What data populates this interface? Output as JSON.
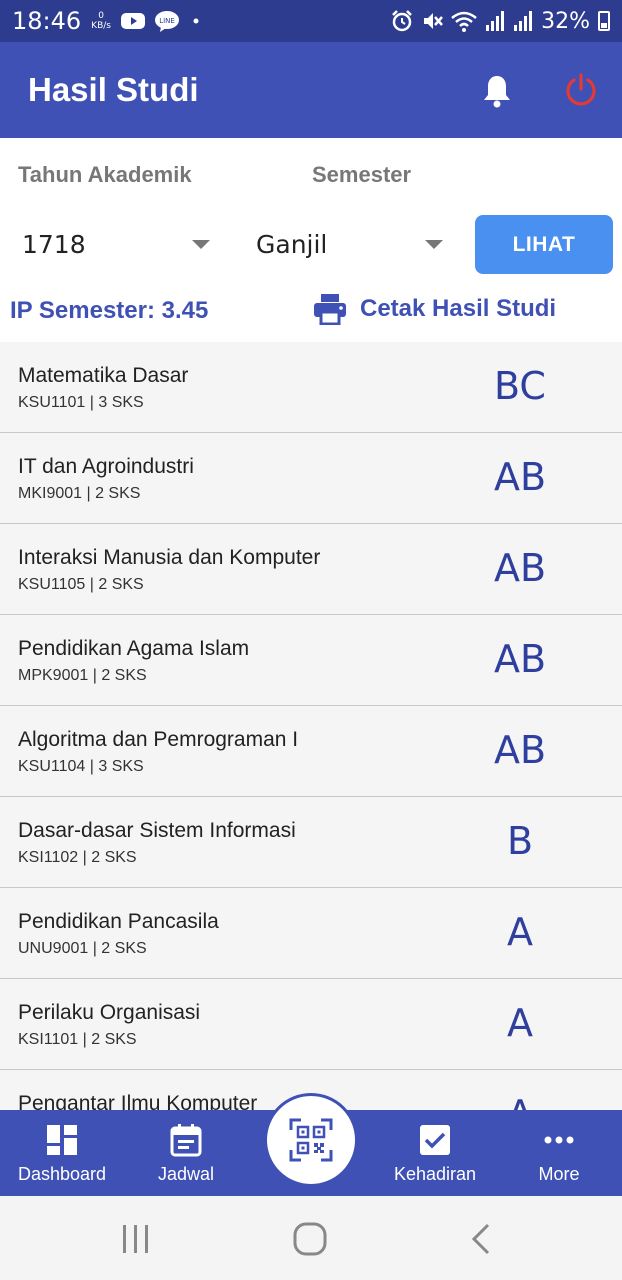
{
  "status_bar": {
    "time": "18:46",
    "net_speed_value": "0",
    "net_speed_unit": "KB/s",
    "battery": "32%"
  },
  "app_bar": {
    "title": "Hasil Studi"
  },
  "filters": {
    "year_label": "Tahun Akademik",
    "semester_label": "Semester",
    "year_value": "1718",
    "semester_value": "Ganjil",
    "view_button": "LIHAT"
  },
  "summary": {
    "ip_text": "IP Semester: 3.45",
    "print_label": "Cetak Hasil Studi"
  },
  "courses": [
    {
      "name": "Matematika Dasar",
      "code": "KSU1101 | 3 SKS",
      "grade": "BC"
    },
    {
      "name": "IT dan Agroindustri",
      "code": "MKI9001 | 2 SKS",
      "grade": "AB"
    },
    {
      "name": "Interaksi Manusia dan Komputer",
      "code": "KSU1105 | 2 SKS",
      "grade": "AB"
    },
    {
      "name": "Pendidikan Agama Islam",
      "code": "MPK9001 | 2 SKS",
      "grade": "AB"
    },
    {
      "name": "Algoritma dan Pemrograman I",
      "code": "KSU1104 | 3 SKS",
      "grade": "AB"
    },
    {
      "name": "Dasar-dasar Sistem Informasi",
      "code": "KSI1102 | 2 SKS",
      "grade": "B"
    },
    {
      "name": "Pendidikan Pancasila",
      "code": "UNU9001 | 2 SKS",
      "grade": "A"
    },
    {
      "name": "Perilaku Organisasi",
      "code": "KSI1101 | 2 SKS",
      "grade": "A"
    },
    {
      "name": "Pengantar Ilmu Komputer",
      "code": "",
      "grade": "A"
    }
  ],
  "bottom_nav": {
    "dashboard": "Dashboard",
    "jadwal": "Jadwal",
    "kehadiran": "Kehadiran",
    "more": "More"
  },
  "colors": {
    "primary": "#3f51b5",
    "status_bar": "#2e3c8f",
    "accent_button": "#4a90f0",
    "power_icon": "#e53935"
  }
}
